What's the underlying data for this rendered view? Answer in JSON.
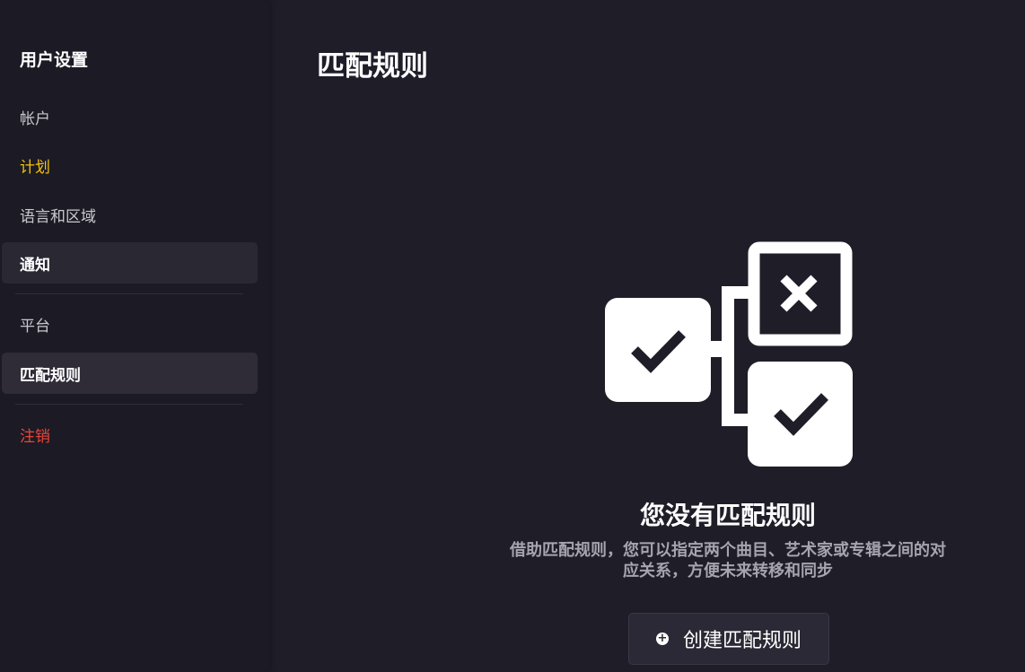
{
  "sidebar": {
    "title": "用户设置",
    "items": [
      {
        "label": "帐户"
      },
      {
        "label": "计划"
      },
      {
        "label": "语言和区域"
      },
      {
        "label": "通知"
      },
      {
        "label": "平台"
      },
      {
        "label": "匹配规则"
      },
      {
        "label": "注销"
      }
    ]
  },
  "main": {
    "title": "匹配规则",
    "empty_state": {
      "title": "您没有匹配规则",
      "description_line1": "借助匹配规则，您可以指定两个曲目、艺术家或专辑之间的对",
      "description_line2": "应关系，方便未来转移和同步",
      "button_label": "创建匹配规则"
    }
  },
  "colors": {
    "background": "#1f1d28",
    "sidebar": "#1c1a24",
    "plan_accent": "#f1c40f",
    "logout_accent": "#e8473b"
  }
}
